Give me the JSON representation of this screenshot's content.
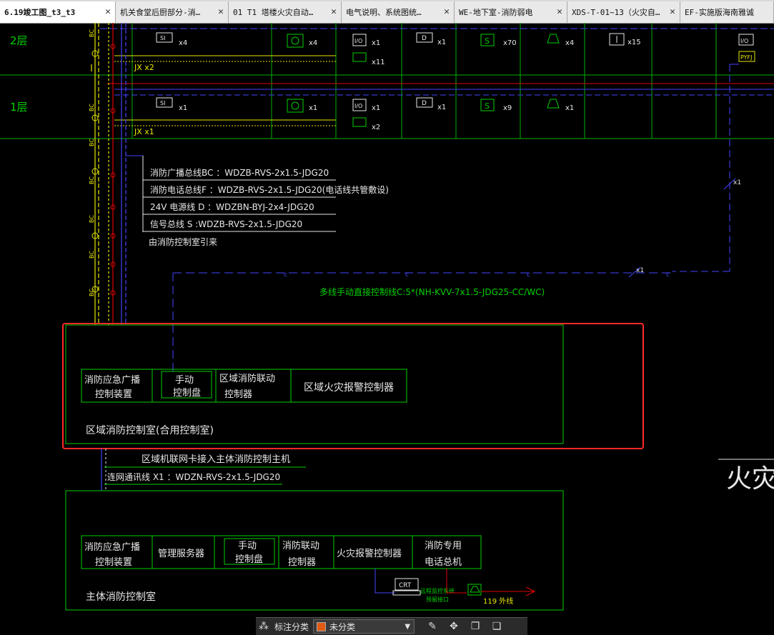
{
  "tabs": [
    {
      "label": "6.19竣工图_t3_t3",
      "active": true
    },
    {
      "label": "机关食堂后厨部分-消…",
      "active": false
    },
    {
      "label": "01 T1 塔楼火灾自动…",
      "active": false
    },
    {
      "label": "电气说明、系统图统…",
      "active": false
    },
    {
      "label": "WE-地下室-消防弱电",
      "active": false
    },
    {
      "label": "XDS-T-01~13（火灾自…",
      "active": false
    },
    {
      "label": "EF-实施版海南雅诚",
      "active": false
    }
  ],
  "close_glyph": "✕",
  "floors": [
    "2层",
    "1层"
  ],
  "riser_labels": {
    "bc": "BC",
    "f": "F",
    "jx2": "JX  x2",
    "jx1": "JX  x1"
  },
  "devices_floor2": [
    {
      "symbol": "SI",
      "count": "x4"
    },
    {
      "symbol": "bell",
      "count": "x4"
    },
    {
      "symbol": "I/O",
      "count": "x1",
      "sub": "x11"
    },
    {
      "symbol": "D",
      "count": "x1"
    },
    {
      "symbol": "S",
      "count": "x70"
    },
    {
      "symbol": "alarm",
      "count": "x4"
    },
    {
      "symbol": "arrow",
      "count": "x15"
    },
    {
      "symbol": "I/O",
      "extra": "PYFJ"
    }
  ],
  "devices_floor1": [
    {
      "symbol": "SI",
      "count": "x1"
    },
    {
      "symbol": "bell",
      "count": "x1"
    },
    {
      "symbol": "I/O",
      "count": "x1",
      "sub": "x2"
    },
    {
      "symbol": "D",
      "count": "x1"
    },
    {
      "symbol": "S",
      "count": "x9"
    },
    {
      "symbol": "alarm",
      "count": "x1"
    }
  ],
  "legend": {
    "l1": "消防广播总线BC ：WDZB-RVS-2x1.5-JDG20",
    "l2": "消防电话总线F  ：WDZB-RVS-2x1.5-JDG20(电话线共管敷设)",
    "l3": "24V  电源线  D    ：WDZBN-BYJ-2x4-JDG20",
    "l4": "信号总线  S      :WDZB-RVS-2x1.5-JDG20",
    "l5": "由消防控制室引来"
  },
  "c_line": {
    "mark": "c",
    "count": "x1",
    "label": "多线手动直接控制线C:5*(NH-KVV-7x1.5-JDG25-CC/WC)"
  },
  "right_riser_count": "x1",
  "regional_room": {
    "units": [
      "消防应急广播\n控制装置",
      "手动\n控制盘",
      "区域消防联动\n控制器",
      "区域火灾报警控制器"
    ],
    "title": "区域消防控制室(合用控制室)"
  },
  "link_text": "区域机联网卡接入主体消防控制主机",
  "network_line": "连网通讯线 X1 ：WDZN-RVS-2x1.5-JDG20",
  "main_room": {
    "units": [
      "消防应急广播\n控制装置",
      "管理服务器",
      "手动\n控制盘",
      "消防联动\n控制器",
      "火灾报警控制器",
      "消防专用\n电话总机"
    ],
    "title": "主体消防控制室",
    "crt": "CRT",
    "remote": "远程监控系统\n预留接口",
    "outside": "119  外线"
  },
  "edge_title": "火灾",
  "bottom_toolbar": {
    "label": "标注分类",
    "selected": "未分类",
    "swatch_color": "#e05a14"
  },
  "colors": {
    "green": "#00d000",
    "red": "#e00000",
    "blue": "#4444ff",
    "yellow": "#e8e800",
    "white": "#e8e8e8",
    "highlight": "#ff2a2a"
  }
}
